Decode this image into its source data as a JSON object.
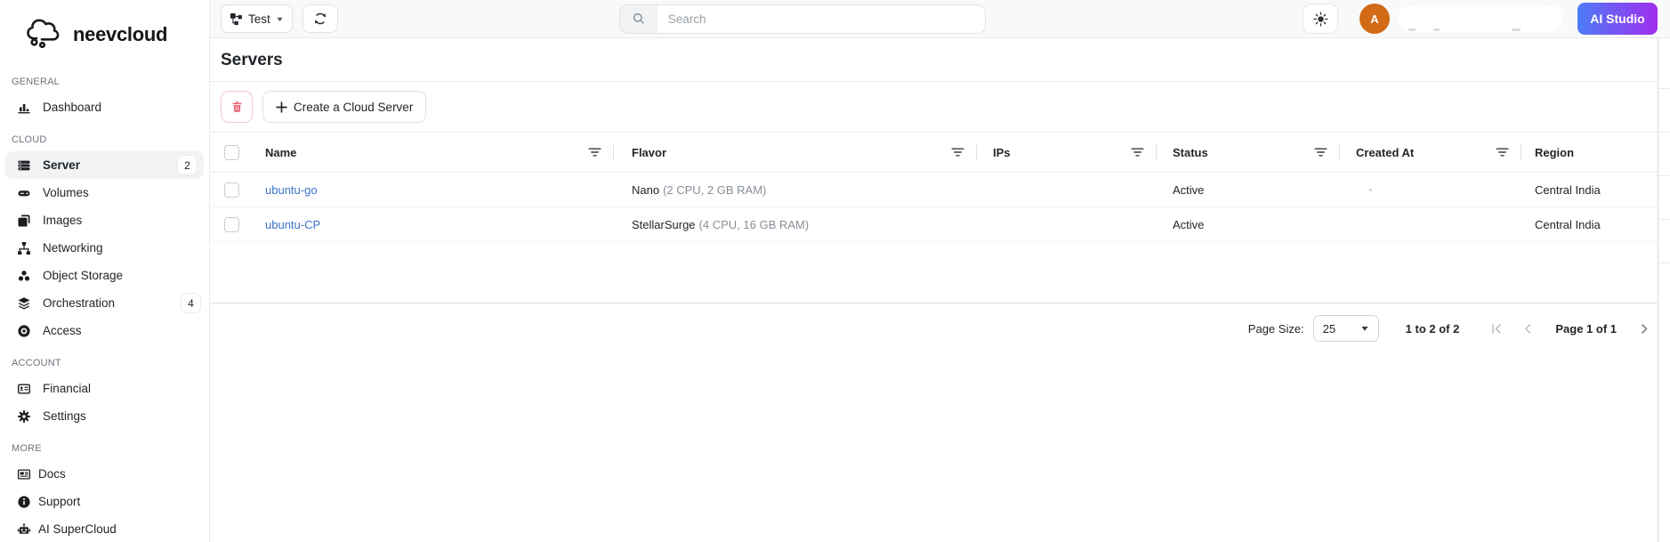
{
  "brand": {
    "name": "neevcloud"
  },
  "header": {
    "project_button": {
      "label": "Test"
    },
    "search": {
      "placeholder": "Search"
    },
    "avatar_initial": "A",
    "ai_studio_button": "AI Studio"
  },
  "sidebar": {
    "sections": [
      {
        "label": "GENERAL",
        "items": [
          {
            "label": "Dashboard",
            "icon": "dashboard-icon"
          }
        ]
      },
      {
        "label": "CLOUD",
        "items": [
          {
            "label": "Server",
            "icon": "server-icon",
            "badge": "2",
            "active": true
          },
          {
            "label": "Volumes",
            "icon": "volumes-icon"
          },
          {
            "label": "Images",
            "icon": "images-icon"
          },
          {
            "label": "Networking",
            "icon": "networking-icon"
          },
          {
            "label": "Object Storage",
            "icon": "object-storage-icon"
          },
          {
            "label": "Orchestration",
            "icon": "orchestration-icon",
            "badge": "4"
          },
          {
            "label": "Access",
            "icon": "access-icon"
          }
        ]
      },
      {
        "label": "ACCOUNT",
        "items": [
          {
            "label": "Financial",
            "icon": "financial-icon"
          },
          {
            "label": "Settings",
            "icon": "settings-icon"
          }
        ]
      },
      {
        "label": "MORE",
        "items": [
          {
            "label": "Docs",
            "icon": "docs-icon"
          },
          {
            "label": "Support",
            "icon": "support-icon"
          },
          {
            "label": "AI SuperCloud",
            "icon": "ai-supercloud-icon"
          }
        ]
      }
    ]
  },
  "main": {
    "title": "Servers",
    "toolbar": {
      "create_server_button": "Create a Cloud Server"
    },
    "table": {
      "columns": [
        {
          "label": "Name",
          "filter": true
        },
        {
          "label": "Flavor",
          "filter": true
        },
        {
          "label": "IPs",
          "filter": true
        },
        {
          "label": "Status",
          "filter": true
        },
        {
          "label": "Created At",
          "filter": true
        },
        {
          "label": "Region",
          "filter": false
        }
      ],
      "rows": [
        {
          "name": "ubuntu-go",
          "flavor_name": "Nano",
          "flavor_specs": "(2 CPU, 2 GB RAM)",
          "ips": "",
          "status": "Active",
          "created_at": "",
          "region": "Central India"
        },
        {
          "name": "ubuntu-CP",
          "flavor_name": "StellarSurge",
          "flavor_specs": "(4 CPU, 16 GB RAM)",
          "ips": "",
          "status": "Active",
          "created_at": "",
          "region": "Central India"
        }
      ]
    },
    "pagination": {
      "page_size_label": "Page Size:",
      "page_size_value": "25",
      "range_text": "1 to 2 of 2",
      "page_text": "Page 1 of 1"
    }
  },
  "colors": {
    "accent_link": "#3b71ca",
    "danger": "#e4606d",
    "avatar_bg": "#d26a16",
    "ai_studio_gradient_start": "#4d7cf7",
    "ai_studio_gradient_end": "#a02ded"
  }
}
